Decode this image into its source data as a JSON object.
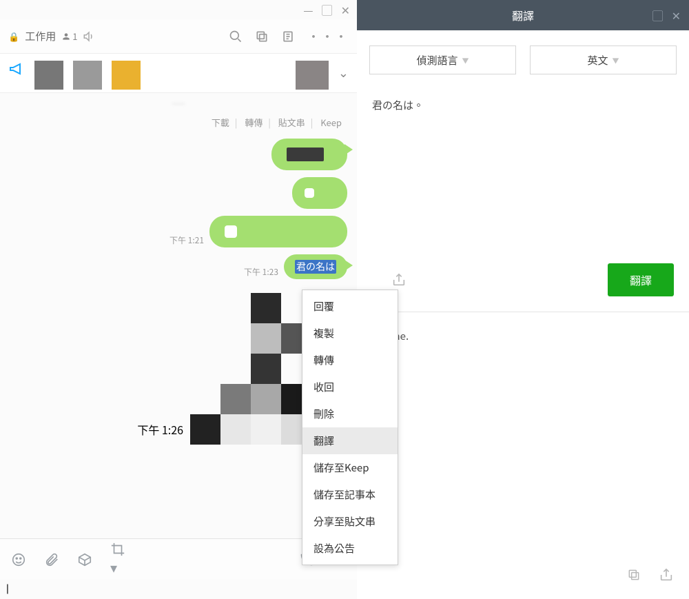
{
  "chat": {
    "title": "工作用",
    "member_count": "1",
    "link_row": {
      "download": "下載",
      "forward": "轉傳",
      "timeline": "貼文串",
      "keep": "Keep"
    },
    "messages": {
      "ts1": "下午 1:21",
      "ts2": "下午 1:23",
      "ts3": "下午 1:26",
      "text_message": "君の名は"
    }
  },
  "context_menu": {
    "reply": "回覆",
    "copy": "複製",
    "forward": "轉傳",
    "unsend": "收回",
    "delete": "刪除",
    "translate": "翻譯",
    "save_keep": "儲存至Keep",
    "save_note": "儲存至記事本",
    "share_timeline": "分享至貼文串",
    "set_announce": "設為公告"
  },
  "translate": {
    "title": "翻譯",
    "src_lang": "偵測語言",
    "tgt_lang": "英文",
    "src_text": "君の名は。",
    "button": "翻譯",
    "out_text": "r name."
  }
}
